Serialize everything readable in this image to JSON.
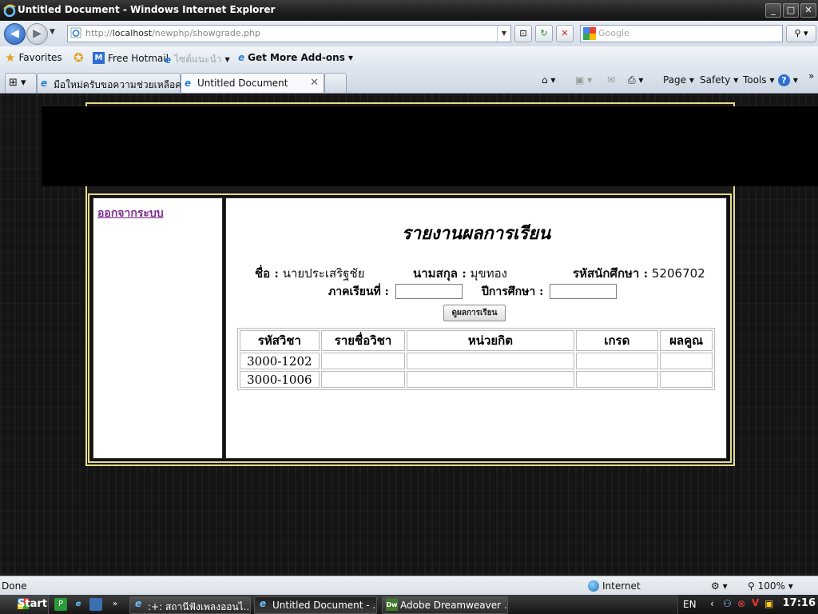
{
  "window": {
    "title": "Untitled Document - Windows Internet Explorer",
    "controls": [
      "_",
      "□",
      "✕"
    ]
  },
  "address": {
    "url_prefix": "http://",
    "url_host": "localhost",
    "url_path": "/newphp/showgrade.php"
  },
  "search": {
    "placeholder": "Google"
  },
  "favorites": {
    "favorites_label": "Favorites",
    "free_hotmail": "Free Hotmail",
    "suggested_sites": "ไซต์แนะนำ",
    "get_addons": "Get More Add-ons"
  },
  "tabs": [
    {
      "label": "มือใหม่ครับขอความช่วยเหลือค..."
    },
    {
      "label": "Untitled Document"
    }
  ],
  "commandbar": {
    "page": "Page",
    "safety": "Safety",
    "tools": "Tools",
    "help": "?"
  },
  "sidebar": {
    "logout_link": "ออกจากระบบ"
  },
  "report": {
    "title": "รายงานผลการเรียน",
    "name_label": "ชื่อ :",
    "name_value": "นายประเสริฐชัย",
    "surname_label": "นามสกุล :",
    "surname_value": "มุขทอง",
    "student_id_label": "รหัสนักศึกษา :",
    "student_id_value": "5206702",
    "semester_label": "ภาคเรียนที่ :",
    "semester_value": "",
    "year_label": "ปีการศึกษา :",
    "year_value": "",
    "show_button": "ดูผลการเรียน"
  },
  "grades_table": {
    "headers": [
      "รหัสวิชา",
      "รายชื่อวิชา",
      "หน่วยกิต",
      "เกรด",
      "ผลคูณ"
    ],
    "rows": [
      [
        "3000-1202",
        "",
        "",
        "",
        ""
      ],
      [
        "3000-1006",
        "",
        "",
        "",
        ""
      ]
    ]
  },
  "status": {
    "text": "Done",
    "zone": "Internet",
    "zoom": "100%"
  },
  "taskbar": {
    "start": "Start",
    "tasks": [
      {
        "label": ":+: สถานีฟังเพลงออนไ..."
      },
      {
        "label": "Untitled Document - ..."
      },
      {
        "label": "Adobe Dreamweaver ..."
      }
    ],
    "language": "EN",
    "clock": "17:16"
  }
}
